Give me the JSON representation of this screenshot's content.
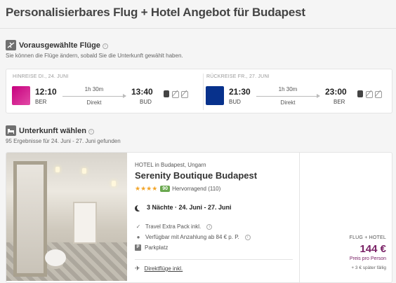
{
  "page": {
    "title": "Personalisierbares Flug + Hotel Angebot für Budapest"
  },
  "flights_section": {
    "icon": "plane-icon",
    "title": "Vorausgewählte Flüge",
    "subtitle": "Sie können die Flüge ändern, sobald Sie die Unterkunft gewählt haben."
  },
  "outbound": {
    "label": "HINREISE DI., 24. JUNI",
    "airline_logo": "wizz-air-logo",
    "dep_time": "12:10",
    "dep_airport": "BER",
    "duration": "1h 30m",
    "type": "Direkt",
    "arr_time": "13:40",
    "arr_airport": "BUD"
  },
  "return": {
    "label": "RÜCKREISE FR., 27. JUNI",
    "airline_logo": "ryanair-logo",
    "dep_time": "21:30",
    "dep_airport": "BUD",
    "duration": "1h 30m",
    "type": "Direkt",
    "arr_time": "23:00",
    "arr_airport": "BER"
  },
  "hotel_section": {
    "icon": "bed-icon",
    "title": "Unterkunft wählen",
    "subtitle": "95 Ergebnisse für 24. Juni - 27. Juni gefunden"
  },
  "hotel": {
    "meta": "HOTEL in Budapest, Ungarn",
    "name": "Serenity Boutique Budapest",
    "stars": "★★★★",
    "score": "90",
    "score_text": "Hervorragend (110)",
    "nights": "3 Nächte · 24. Juni - 27. Juni",
    "features": [
      "Travel Extra Pack inkl.",
      "Verfügbar mit Anzahlung ab 84 € p. P.",
      "Parkplatz"
    ],
    "direct_flights": "Direktflüge inkl."
  },
  "price": {
    "label": "FLUG + HOTEL",
    "value": "144 €",
    "per": "Preis pro Person",
    "later": "+ 3 € später fällig"
  },
  "colors": {
    "accent": "#7a2266",
    "score_green": "#6aa84f",
    "stars": "#f2a52a"
  }
}
